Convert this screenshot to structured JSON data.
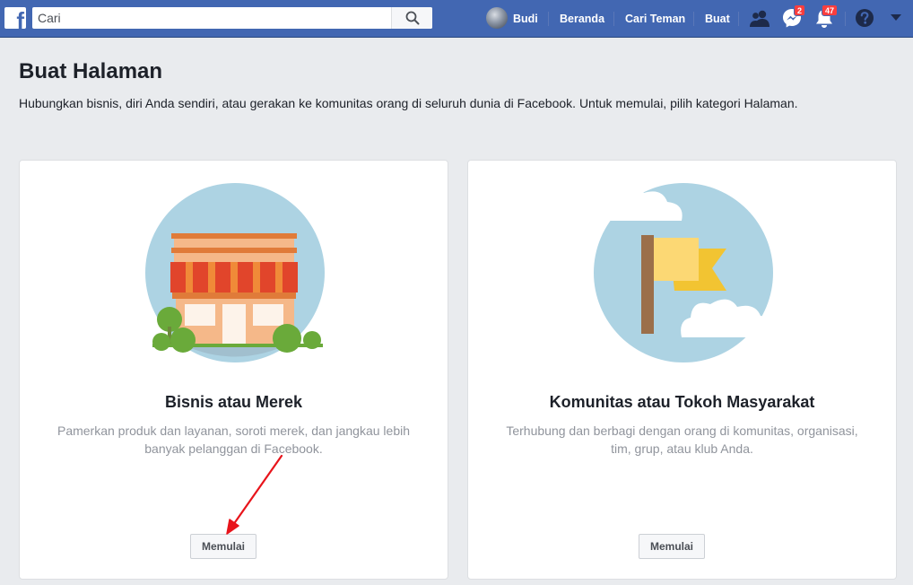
{
  "topbar": {
    "search_placeholder": "Cari",
    "user_name": "Budi",
    "nav_home": "Beranda",
    "nav_find_friends": "Cari Teman",
    "nav_create": "Buat",
    "messages_badge": "2",
    "notifications_badge": "47"
  },
  "page": {
    "title": "Buat Halaman",
    "description": "Hubungkan bisnis, diri Anda sendiri, atau gerakan ke komunitas orang di seluruh dunia di Facebook. Untuk memulai, pilih kategori Halaman."
  },
  "cards": [
    {
      "title": "Bisnis atau Merek",
      "description": "Pamerkan produk dan layanan, soroti merek, dan jangkau lebih banyak pelanggan di Facebook.",
      "button": "Memulai"
    },
    {
      "title": "Komunitas atau Tokoh Masyarakat",
      "description": "Terhubung dan berbagi dengan orang di komunitas, organisasi, tim, grup, atau klub Anda.",
      "button": "Memulai"
    }
  ],
  "colors": {
    "brand": "#4267b2",
    "background": "#e9ebee",
    "annotation_arrow": "#e8141b"
  },
  "icons": [
    "facebook-logo-icon",
    "search-icon",
    "friend-requests-icon",
    "messenger-icon",
    "notifications-icon",
    "help-icon",
    "dropdown-arrow-icon"
  ]
}
